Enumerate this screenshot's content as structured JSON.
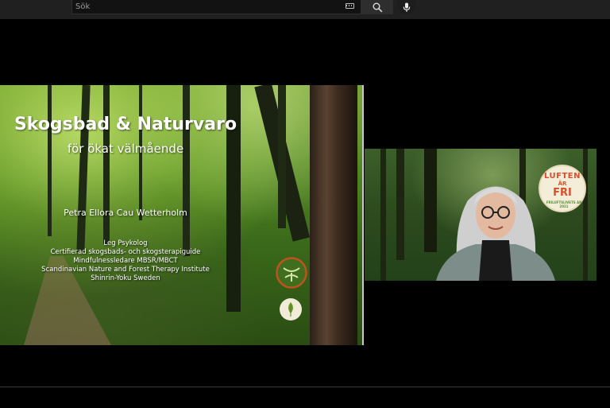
{
  "search": {
    "placeholder": "Sök"
  },
  "slide": {
    "title": "Skogsbad & Naturvaro",
    "subtitle": "för ökat välmående",
    "author": "Petra Ellora Cau Wetterholm",
    "credentials": [
      "Leg Psykolog",
      "Certifierad skogsbads- och skogsterapiguide",
      "Mindfulnessledare MBSR/MBCT",
      "Scandinavian Nature and Forest Therapy Institute",
      "Shinrin-Yoku Sweden"
    ]
  },
  "badge": {
    "line1": "LUFTEN",
    "line2": "ÄR",
    "line3": "FRI",
    "line4": "FRILUFTSLIVETS ÅR 2021"
  },
  "colors": {
    "topbar": "#202020",
    "background": "#000000",
    "badge_text": "#d94f2b",
    "badge_bg": "#f4eed9"
  }
}
